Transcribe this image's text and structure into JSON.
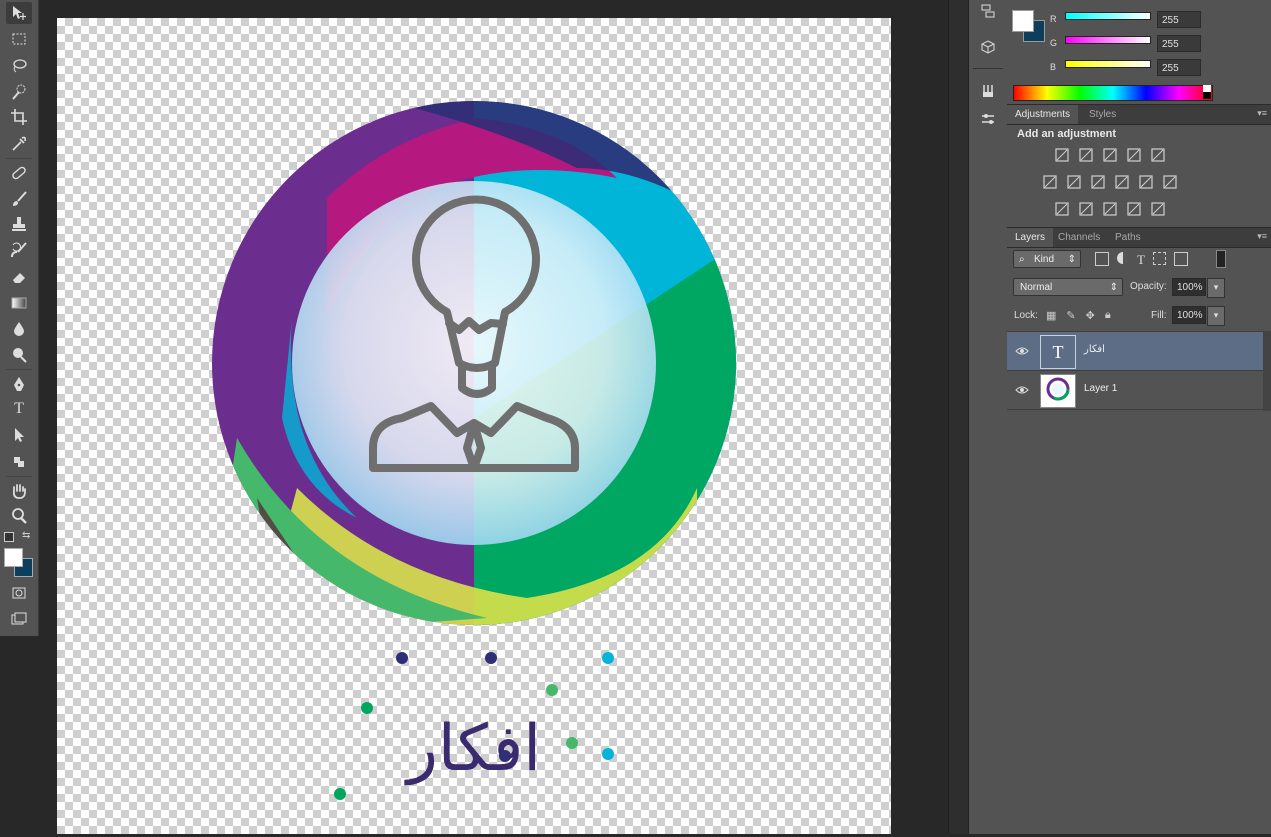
{
  "toolbar": {
    "tools": [
      {
        "name": "move-tool",
        "icon": "move-icon",
        "selected": true
      },
      {
        "name": "marquee-tool",
        "icon": "marquee-icon"
      },
      {
        "name": "lasso-tool",
        "icon": "lasso-icon"
      },
      {
        "name": "quick-selection-tool",
        "icon": "quick-selection-icon"
      },
      {
        "name": "crop-tool",
        "icon": "crop-icon"
      },
      {
        "name": "eyedropper-tool",
        "icon": "eyedropper-icon"
      },
      {
        "name": "healing-brush-tool",
        "icon": "bandage-icon"
      },
      {
        "name": "brush-tool",
        "icon": "brush-icon"
      },
      {
        "name": "clone-stamp-tool",
        "icon": "stamp-icon"
      },
      {
        "name": "history-brush-tool",
        "icon": "history-brush-icon"
      },
      {
        "name": "eraser-tool",
        "icon": "eraser-icon"
      },
      {
        "name": "gradient-tool",
        "icon": "gradient-icon"
      },
      {
        "name": "blur-tool",
        "icon": "drop-icon"
      },
      {
        "name": "dodge-tool",
        "icon": "dodge-icon"
      },
      {
        "name": "pen-tool",
        "icon": "pen-icon"
      },
      {
        "name": "type-tool",
        "icon": "type-icon",
        "glyph": "T"
      },
      {
        "name": "path-selection-tool",
        "icon": "arrow-icon"
      },
      {
        "name": "shape-tool",
        "icon": "shape-icon"
      },
      {
        "name": "hand-tool",
        "icon": "hand-icon"
      },
      {
        "name": "zoom-tool",
        "icon": "zoom-icon"
      }
    ],
    "foreground_color": "#ffffff",
    "background_color": "#0d3f5c"
  },
  "document": {
    "logo_text": "افكار",
    "icon": "lightbulb-person-icon",
    "ring_colors": [
      "#6b2d8e",
      "#b5197f",
      "#00b5d8",
      "#00a65c",
      "#d9e24a",
      "#2f2f77"
    ]
  },
  "color_panel": {
    "channels": [
      {
        "label": "R",
        "value": "255",
        "color": "#00ffff"
      },
      {
        "label": "G",
        "value": "255",
        "color": "#ff00ff"
      },
      {
        "label": "B",
        "value": "255",
        "color": "#ffff00"
      }
    ]
  },
  "adjustments": {
    "tabs": [
      "Adjustments",
      "Styles"
    ],
    "heading": "Add an adjustment",
    "icons": [
      "brightness-icon",
      "levels-icon",
      "curves-icon",
      "exposure-icon",
      "vibrance-icon",
      "hue-saturation-icon",
      "color-balance-icon",
      "black-white-icon",
      "photo-filter-icon",
      "channel-mixer-icon",
      "color-lookup-icon",
      "invert-icon",
      "posterize-icon",
      "threshold-icon",
      "selective-color-icon",
      "gradient-map-icon"
    ]
  },
  "layers": {
    "tabs": [
      "Layers",
      "Channels",
      "Paths"
    ],
    "filter_kind": "Kind",
    "blend_mode": "Normal",
    "opacity_label": "Opacity:",
    "opacity_value": "100%",
    "lock_label": "Lock:",
    "fill_label": "Fill:",
    "fill_value": "100%",
    "items": [
      {
        "name": "افكار",
        "type": "text",
        "selected": true,
        "thumb_glyph": "T"
      },
      {
        "name": "Layer 1",
        "type": "image",
        "selected": false
      }
    ]
  }
}
